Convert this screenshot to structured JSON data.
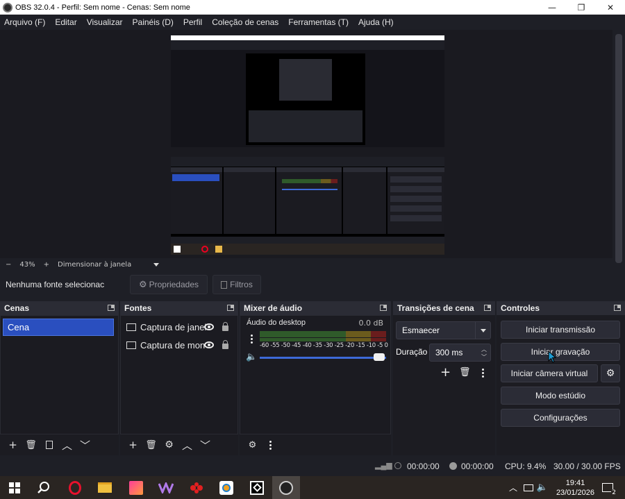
{
  "window": {
    "title": "OBS 32.0.4 - Perfil: Sem nome - Cenas: Sem nome",
    "minimize_icon": "—",
    "maximize_icon": "❐",
    "close_icon": "✕"
  },
  "menu": [
    "Arquivo (F)",
    "Editar",
    "Visualizar",
    "Painéis (D)",
    "Perfil",
    "Coleção de cenas",
    "Ferramentas (T)",
    "Ajuda (H)"
  ],
  "zoom": {
    "minus": "−",
    "value": "43%",
    "plus": "+",
    "mode": "Dimensionar à janela"
  },
  "source_toolbar": {
    "no_source": "Nenhuma fonte selecionac",
    "properties": "Propriedades",
    "filters": "Filtros"
  },
  "scenes": {
    "title": "Cenas",
    "items": [
      "Cena"
    ]
  },
  "sources": {
    "title": "Fontes",
    "items": [
      "Captura de janel",
      "Captura de mon"
    ]
  },
  "mixer": {
    "title": "Mixer de áudio",
    "channel": "Áudio do desktop",
    "level": "0.0 dB",
    "ticks": "-60 -55 -50 -45 -40 -35 -30 -25 -20 -15 -10  -5   0"
  },
  "transitions": {
    "title": "Transições de cena",
    "selected": "Esmaecer",
    "duration_label": "Duração",
    "duration_value": "300 ms"
  },
  "controls": {
    "title": "Controles",
    "start_stream": "Iniciar transmissão",
    "start_record": "Iniciar gravação",
    "virtual_cam": "Iniciar câmera virtual",
    "studio_mode": "Modo estúdio",
    "settings": "Configurações"
  },
  "status": {
    "stream_time": "00:00:00",
    "record_time": "00:00:00",
    "cpu": "CPU: 9.4%",
    "fps": "30.00 / 30.00 FPS"
  },
  "taskbar": {
    "time": "19:41",
    "date": "23/01/2026",
    "notifications": "2"
  }
}
